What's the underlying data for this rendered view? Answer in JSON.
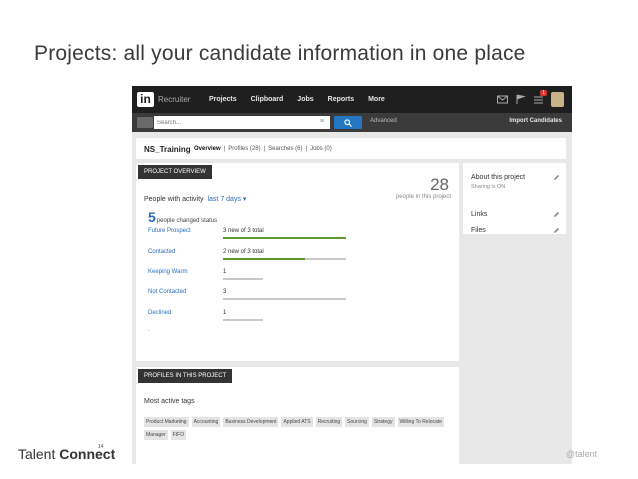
{
  "slide": {
    "title": "Projects: all your candidate information in one place",
    "footer_brand_light": "Talent ",
    "footer_brand_bold": "Connect",
    "footer_year": "14",
    "handle": "@talent"
  },
  "topbar": {
    "logo_text": "in",
    "product": "Recruiter",
    "nav": [
      "Projects",
      "Clipboard",
      "Jobs",
      "Reports",
      "More"
    ],
    "notification_count": "1"
  },
  "search": {
    "placeholder": "Search...",
    "advanced_label": "Advanced",
    "import_label": "Import Candidates"
  },
  "project": {
    "name": "NS_Training",
    "tabs": [
      "Overview",
      "Profiles (28)",
      "Searches (6)",
      "Jobs (0)"
    ],
    "separators": [
      "|",
      "|",
      "|"
    ]
  },
  "overview": {
    "header": "PROJECT OVERVIEW",
    "activity_label": "People with activity",
    "activity_range": "last 7 days ▾",
    "people_count": "28",
    "people_label": "people in this project",
    "changed_count": "5",
    "changed_label": "people changed status",
    "statuses": [
      {
        "name": "Future Prospect",
        "count": "3 new of 3 total",
        "fill": 1.0
      },
      {
        "name": "Contacted",
        "count": "2 new of 3 total",
        "fill": 0.67
      },
      {
        "name": "Keeping Warm",
        "count": "1",
        "fill": 0
      },
      {
        "name": "Not Contacted",
        "count": "3",
        "fill": 0
      },
      {
        "name": "Declined",
        "count": "1",
        "fill": 0
      }
    ],
    "trailing_dot": "."
  },
  "side": {
    "about": "About this project",
    "sharing": "Sharing is ON",
    "links": "Links",
    "files": "Files"
  },
  "profiles": {
    "header": "PROFILES IN THIS PROJECT",
    "most_active_tags": "Most active tags",
    "tags": [
      "Product Marketing",
      "Accounting",
      "Business Development",
      "Applied ATS",
      "Recruiting",
      "Sourcing",
      "Strategy",
      "Willing To Relocate",
      "Manager",
      "FIFO"
    ]
  },
  "colors": {
    "topbar": "#1f1f1f",
    "searchbar": "#3b3b3b",
    "accent_blue": "#2478c2",
    "link_blue": "#2a6ebb",
    "progress_green": "#5b9b2e"
  }
}
